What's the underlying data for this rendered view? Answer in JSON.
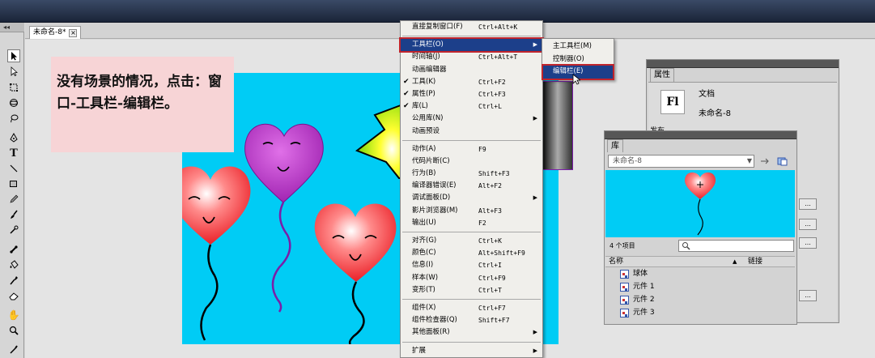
{
  "document_tab": {
    "title": "未命名-8*",
    "close_label": "×"
  },
  "toolbar": {
    "collapse_label": "◂◂",
    "tools": [
      "selection-tool",
      "subselection-tool",
      "free-transform-tool",
      "3d-rotation-tool",
      "lasso-tool",
      "pen-tool",
      "text-tool",
      "line-tool",
      "rectangle-tool",
      "pencil-tool",
      "brush-tool",
      "deco-tool",
      "bone-tool",
      "paint-bucket-tool",
      "eyedropper-tool",
      "eraser-tool",
      "hand-tool",
      "zoom-tool",
      "stroke-color-tool"
    ]
  },
  "note": {
    "text": "没有场景的情况，点击：窗口-工具栏-编辑栏。"
  },
  "window_menu": {
    "items": [
      {
        "label": "直接复制窗口(F)",
        "shortcut": "Ctrl+Alt+K",
        "sep_after": true
      },
      {
        "label": "工具栏(O)",
        "submenu": true,
        "highlighted": true
      },
      {
        "label": "时间轴(J)",
        "shortcut": "Ctrl+Alt+T"
      },
      {
        "label": "动画编辑器"
      },
      {
        "label": "工具(K)",
        "shortcut": "Ctrl+F2",
        "checked": true
      },
      {
        "label": "属性(P)",
        "shortcut": "Ctrl+F3",
        "checked": true
      },
      {
        "label": "库(L)",
        "shortcut": "Ctrl+L",
        "checked": true
      },
      {
        "label": "公用库(N)",
        "submenu": true
      },
      {
        "label": "动画预设",
        "sep_after": true
      },
      {
        "label": "动作(A)",
        "shortcut": "F9"
      },
      {
        "label": "代码片断(C)"
      },
      {
        "label": "行为(B)",
        "shortcut": "Shift+F3"
      },
      {
        "label": "编译器错误(E)",
        "shortcut": "Alt+F2"
      },
      {
        "label": "调试面板(D)",
        "submenu": true
      },
      {
        "label": "影片浏览器(M)",
        "shortcut": "Alt+F3"
      },
      {
        "label": "输出(U)",
        "shortcut": "F2",
        "sep_after": true
      },
      {
        "label": "对齐(G)",
        "shortcut": "Ctrl+K"
      },
      {
        "label": "颜色(C)",
        "shortcut": "Alt+Shift+F9"
      },
      {
        "label": "信息(I)",
        "shortcut": "Ctrl+I"
      },
      {
        "label": "样本(W)",
        "shortcut": "Ctrl+F9"
      },
      {
        "label": "变形(T)",
        "shortcut": "Ctrl+T",
        "sep_after": true
      },
      {
        "label": "组件(X)",
        "shortcut": "Ctrl+F7"
      },
      {
        "label": "组件检查器(Q)",
        "shortcut": "Shift+F7"
      },
      {
        "label": "其他面板(R)",
        "submenu": true,
        "sep_after": true
      },
      {
        "label": "扩展",
        "submenu": true
      }
    ]
  },
  "toolbar_submenu": {
    "items": [
      {
        "label": "主工具栏(M)"
      },
      {
        "label": "控制器(O)"
      },
      {
        "label": "编辑栏(E)",
        "highlighted": true
      }
    ]
  },
  "properties_panel": {
    "tab": "属性",
    "fl_icon": "Fl",
    "doc_type": "文档",
    "doc_name": "未命名-8",
    "section": "发布",
    "button_label": "..."
  },
  "library_panel": {
    "tab": "库",
    "dropdown_value": "未命名-8",
    "item_count": "4 个项目",
    "col_name": "名称",
    "col_link": "链接",
    "items": [
      "球体",
      "元件 1",
      "元件 2",
      "元件 3"
    ]
  },
  "colors": {
    "stage": "#00ccf5",
    "note_bg": "#f7d4d6",
    "menu_highlight": "#1c3f8a",
    "highlight_border": "#c0242c"
  }
}
